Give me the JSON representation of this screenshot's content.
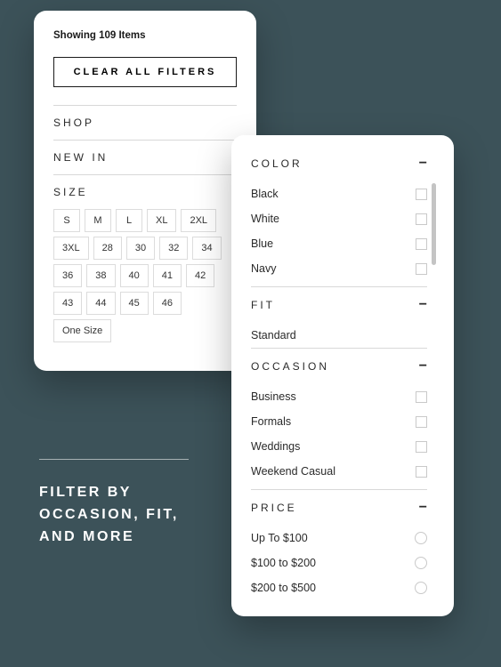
{
  "left": {
    "showing": "Showing 109 Items",
    "clear": "CLEAR ALL FILTERS",
    "sections": {
      "shop": "SHOP",
      "newin": "NEW IN",
      "size": "SIZE"
    },
    "sizes": [
      "S",
      "M",
      "L",
      "XL",
      "2XL",
      "3XL",
      "28",
      "30",
      "32",
      "34",
      "36",
      "38",
      "40",
      "41",
      "42",
      "43",
      "44",
      "45",
      "46",
      "One Size"
    ]
  },
  "right": {
    "color": {
      "title": "COLOR",
      "options": [
        "Black",
        "White",
        "Blue",
        "Navy"
      ]
    },
    "fit": {
      "title": "FIT",
      "options": [
        "Standard"
      ]
    },
    "occasion": {
      "title": "OCCASION",
      "options": [
        "Business",
        "Formals",
        "Weddings",
        "Weekend Casual"
      ]
    },
    "price": {
      "title": "PRICE",
      "options": [
        "Up To $100",
        "$100 to $200",
        "$200 to $500"
      ]
    }
  },
  "tagline": "FILTER BY OCCASION, FIT, AND MORE"
}
